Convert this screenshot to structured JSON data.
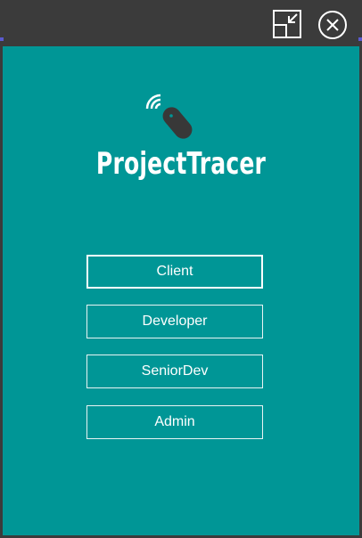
{
  "window": {
    "accent": "#5a5ad0",
    "titlebar_bg": "#3b3b3b",
    "content_bg": "#009696"
  },
  "app": {
    "title": "ProjectTracer",
    "logo_icon": "wireless-mouse-icon"
  },
  "roles": {
    "items": [
      {
        "label": "Client",
        "selected": true
      },
      {
        "label": "Developer",
        "selected": false
      },
      {
        "label": "SeniorDev",
        "selected": false
      },
      {
        "label": "Admin",
        "selected": false
      }
    ]
  },
  "controls": {
    "restore_icon": "restore-down-icon",
    "close_icon": "close-icon"
  }
}
